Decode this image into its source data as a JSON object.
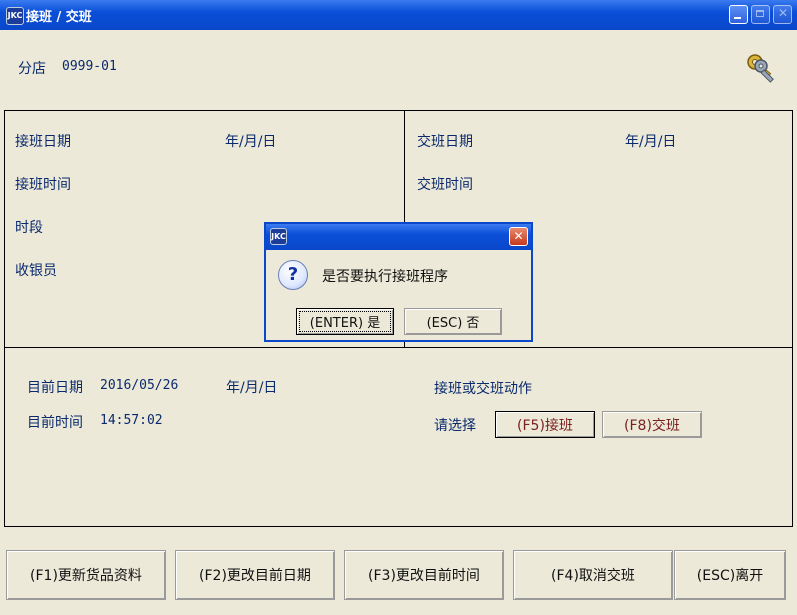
{
  "window": {
    "title": "接班 / 交班",
    "app_icon": "JKC"
  },
  "store": {
    "label": "分店",
    "value": "0999-01"
  },
  "handover_in": {
    "date_label": "接班日期",
    "date_format": "年/月/日",
    "time_label": "接班时间",
    "period_label": "时段",
    "cashier_label": "收银员"
  },
  "handover_out": {
    "date_label": "交班日期",
    "date_format": "年/月/日",
    "time_label": "交班时间"
  },
  "current": {
    "date_label": "目前日期",
    "date_value": "2016/05/26",
    "date_format": "年/月/日",
    "time_label": "目前时间",
    "time_value": "14:57:02",
    "action_title": "接班或交班动作",
    "choose_label": "请选择",
    "f5_label": "(F5)接班",
    "f8_label": "(F8)交班"
  },
  "footer": {
    "f1": "(F1)更新货品资料",
    "f2": "(F2)更改目前日期",
    "f3": "(F3)更改目前时间",
    "f4": "(F4)取消交班",
    "esc": "(ESC)离开"
  },
  "dialog": {
    "icon": "JKC",
    "message": "是否要执行接班程序",
    "yes_label": "(ENTER) 是",
    "no_label": "(ESC) 否"
  }
}
